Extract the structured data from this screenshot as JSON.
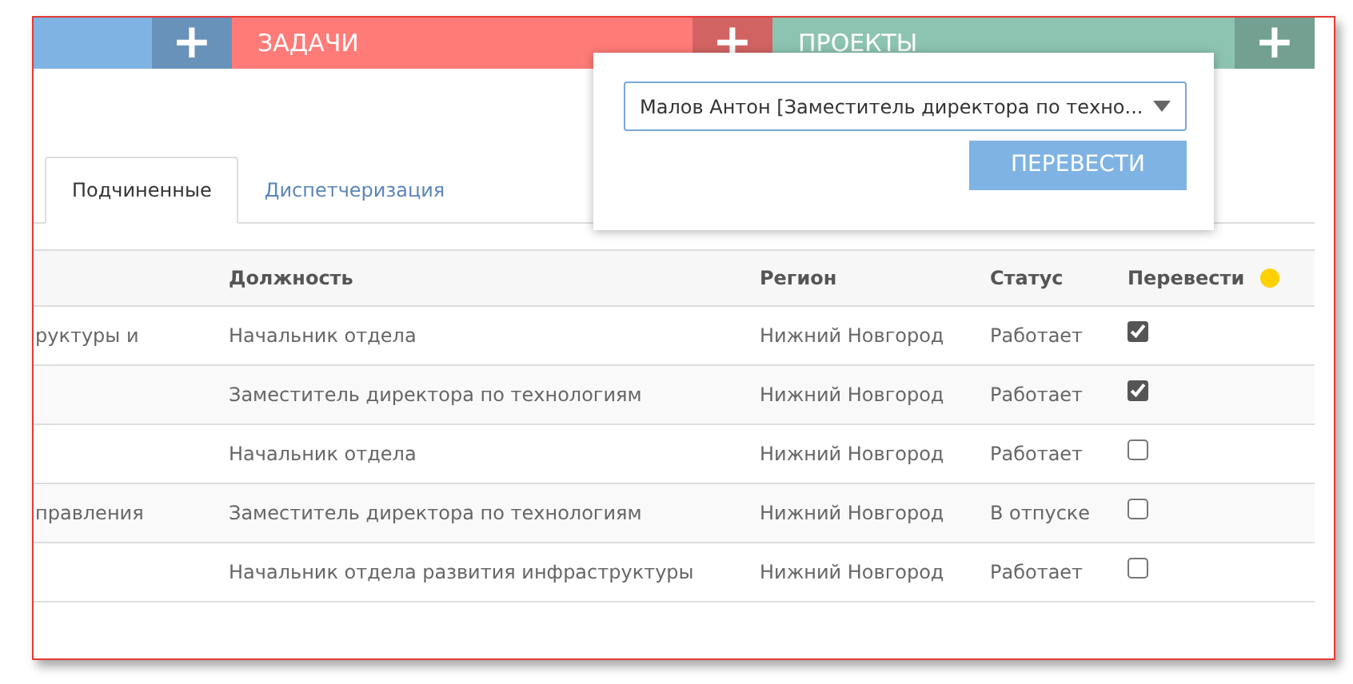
{
  "top_bar": [
    {
      "color": "#7fb3e3"
    },
    {
      "label": "ЗАДАЧИ",
      "color": "#ff7b78"
    },
    {
      "label": "ПРОЕКТЫ",
      "color": "#8dc4b1"
    }
  ],
  "plus_label": "+",
  "tabs": [
    {
      "label": "Подчиненные",
      "selected": true
    },
    {
      "label": "Диспетчеризация",
      "selected": false
    }
  ],
  "table": {
    "columns": [
      "Должность",
      "Регион",
      "Статус",
      "Перевести"
    ],
    "rows": [
      {
        "column_1": "руктуры и",
        "position": "Начальник отдела",
        "region": "Нижний Новгород",
        "status": "Работает",
        "checked": true
      },
      {
        "position": "Заместитель директора по технологиям",
        "region": "Нижний Новгород",
        "status": "Работает",
        "checked": true
      },
      {
        "position": "Начальник отдела",
        "region": "Нижний Новгород",
        "status": "Работает",
        "checked": false
      },
      {
        "column_1": "правления",
        "position": "Заместитель директора по технологиям",
        "region": "Нижний Новгород",
        "status": "В отпуске",
        "checked": false
      },
      {
        "position": "Начальник отдела развития инфраструктуры",
        "region": "Нижний Новгород",
        "status": "Работает",
        "checked": false
      }
    ]
  },
  "popover": {
    "select_value": "Малов Антон [Заместитель директора по техно...",
    "button": "ПЕРЕВЕСТИ"
  }
}
